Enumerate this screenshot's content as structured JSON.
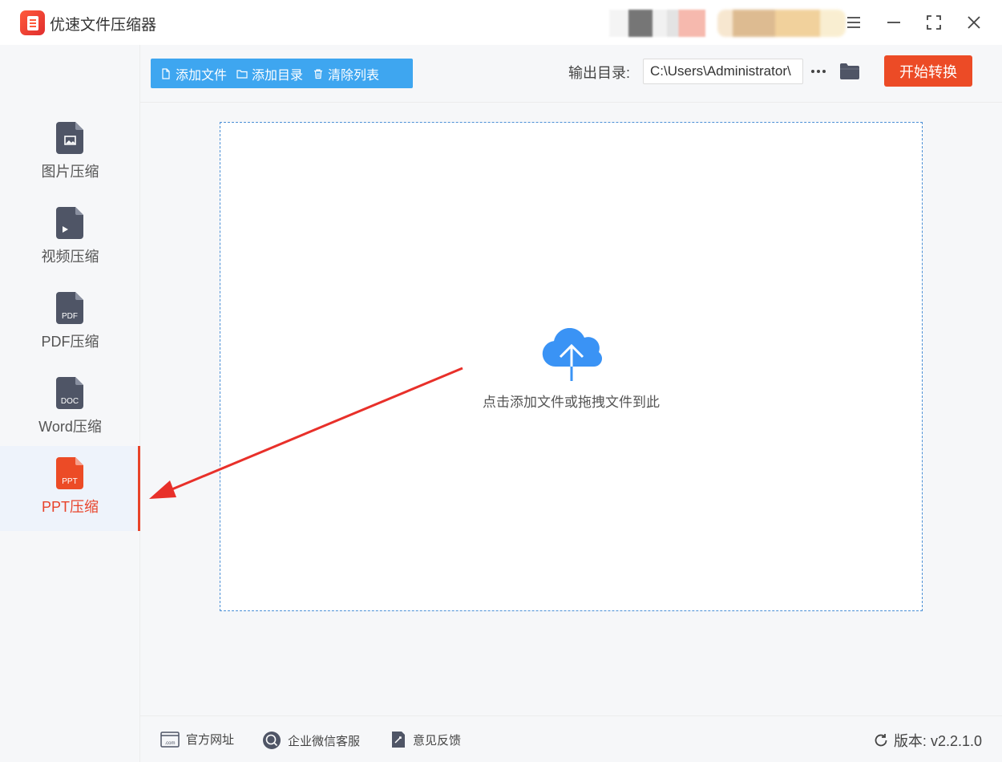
{
  "app": {
    "title": "优速文件压缩器"
  },
  "sidebar": {
    "items": [
      {
        "label": "图片压缩",
        "icon": "image-file-icon",
        "active": false
      },
      {
        "label": "视频压缩",
        "icon": "video-file-icon",
        "active": false
      },
      {
        "label": "PDF压缩",
        "icon": "pdf-file-icon",
        "badge": "PDF",
        "active": false
      },
      {
        "label": "Word压缩",
        "icon": "doc-file-icon",
        "badge": "DOC",
        "active": false
      },
      {
        "label": "PPT压缩",
        "icon": "ppt-file-icon",
        "badge": "PPT",
        "active": true
      }
    ]
  },
  "toolbar": {
    "add_file": "添加文件",
    "add_folder": "添加目录",
    "clear_list": "清除列表",
    "output_label": "输出目录:",
    "output_path": "C:\\Users\\Administrator\\",
    "start": "开始转换"
  },
  "dropzone": {
    "text": "点击添加文件或拖拽文件到此"
  },
  "footer": {
    "website": "官方网址",
    "wechat": "企业微信客服",
    "feedback": "意见反馈",
    "version": "版本: v2.2.1.0"
  },
  "colors": {
    "accent": "#ec4b26",
    "toolbar_blue": "#3ea6f0",
    "icon_gray": "#4f5566",
    "annotation_red": "#e8302a"
  }
}
